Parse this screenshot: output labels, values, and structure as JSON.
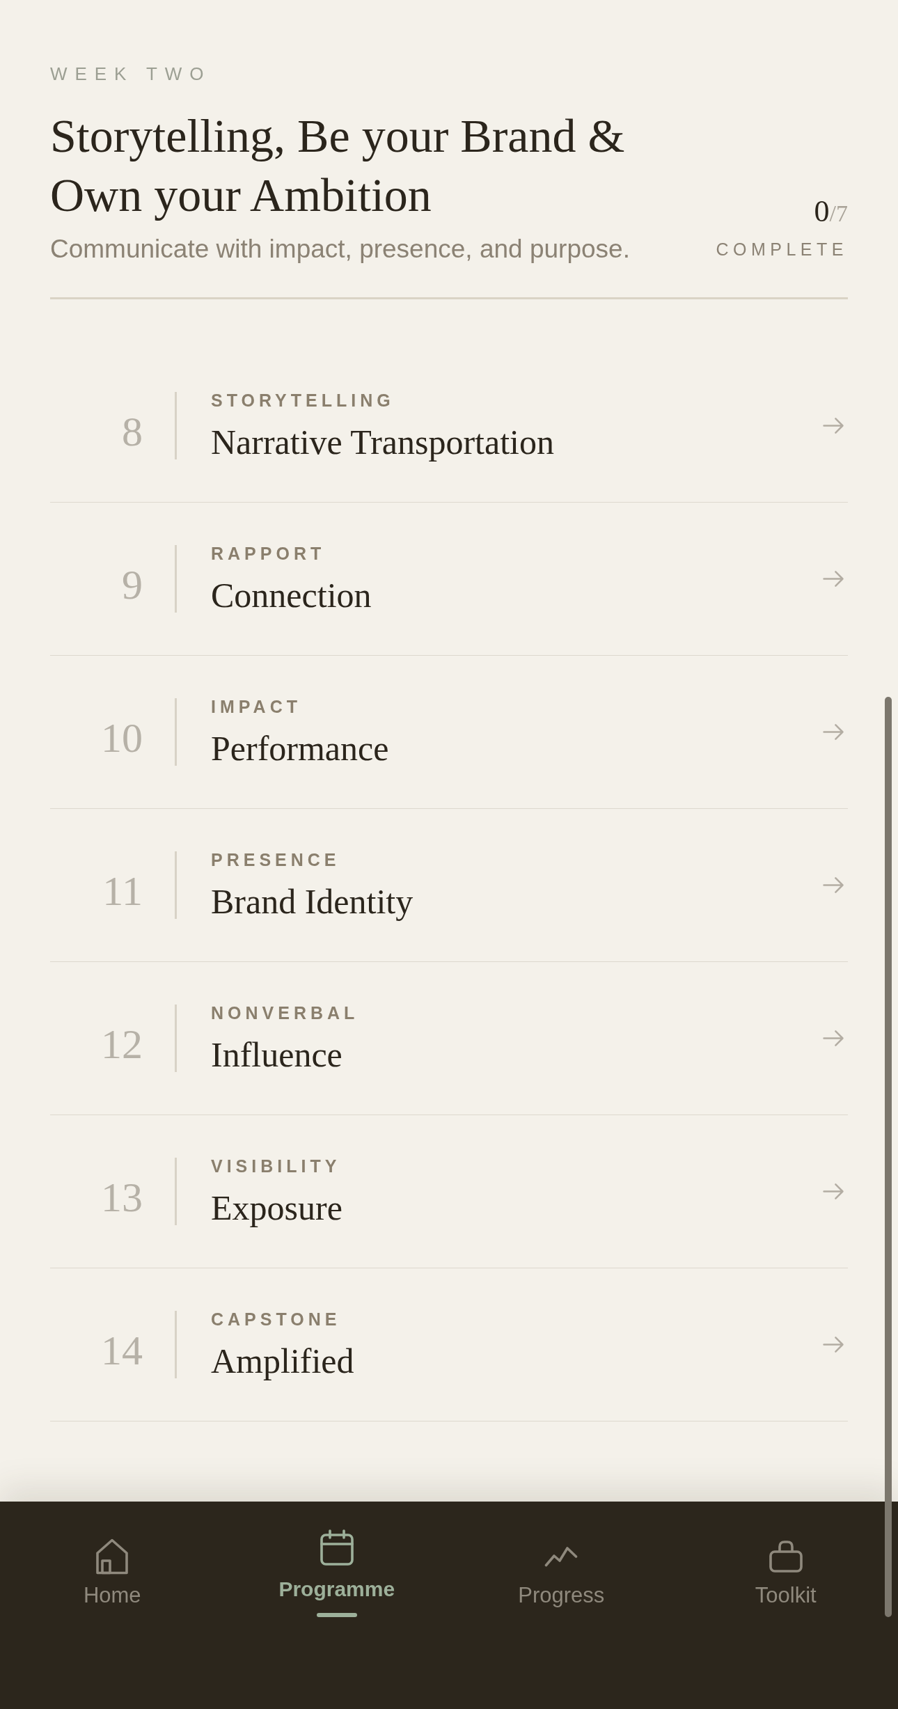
{
  "header": {
    "eyebrow": "WEEK TWO",
    "title": "Storytelling, Be your Brand & Own your Ambition",
    "subtitle": "Communicate with impact, presence, and purpose.",
    "progress": {
      "count": "0",
      "total": "/7",
      "label": "COMPLETE"
    }
  },
  "lessons": [
    {
      "number": "8",
      "category": "STORYTELLING",
      "title": "Narrative Transportation"
    },
    {
      "number": "9",
      "category": "RAPPORT",
      "title": "Connection"
    },
    {
      "number": "10",
      "category": "IMPACT",
      "title": "Performance"
    },
    {
      "number": "11",
      "category": "PRESENCE",
      "title": "Brand Identity"
    },
    {
      "number": "12",
      "category": "NONVERBAL",
      "title": "Influence"
    },
    {
      "number": "13",
      "category": "VISIBILITY",
      "title": "Exposure"
    },
    {
      "number": "14",
      "category": "CAPSTONE",
      "title": "Amplified"
    }
  ],
  "nav": [
    {
      "kind": "home",
      "label": "Home",
      "selected": false
    },
    {
      "kind": "calendar",
      "label": "Programme",
      "selected": true
    },
    {
      "kind": "progress",
      "label": "Progress",
      "selected": false
    },
    {
      "kind": "toolkit",
      "label": "Toolkit",
      "selected": false
    }
  ]
}
